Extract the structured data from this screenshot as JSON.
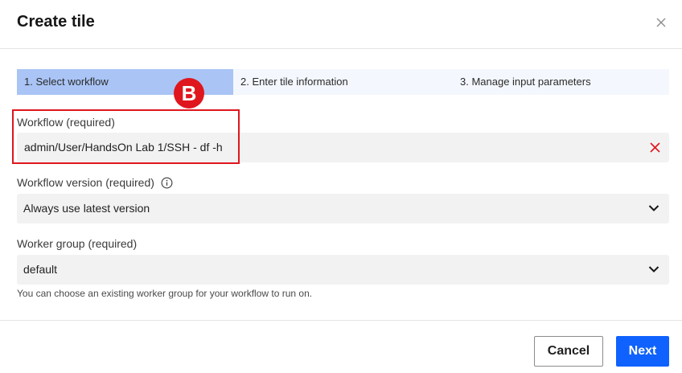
{
  "dialog": {
    "title": "Create tile",
    "close_icon": "close-icon"
  },
  "steps": [
    {
      "label": "1. Select workflow",
      "active": true
    },
    {
      "label": "2. Enter tile information",
      "active": false
    },
    {
      "label": "3. Manage input parameters",
      "active": false
    }
  ],
  "fields": {
    "workflow": {
      "label": "Workflow (required)",
      "value": "admin/User/HandsOn Lab 1/SSH - df -h",
      "clear_icon": "clear-icon"
    },
    "version": {
      "label": "Workflow version (required)",
      "info_icon": "info-icon",
      "value": "Always use latest version"
    },
    "worker_group": {
      "label": "Worker group (required)",
      "value": "default",
      "helper": "You can choose an existing worker group for your workflow to run on."
    }
  },
  "annotation": {
    "marker": "B"
  },
  "footer": {
    "cancel_label": "Cancel",
    "next_label": "Next"
  },
  "colors": {
    "accent": "#0f62fe",
    "active_step": "#a9c4f5",
    "annotation": "#e0161e",
    "clear_icon": "#e0161e"
  }
}
